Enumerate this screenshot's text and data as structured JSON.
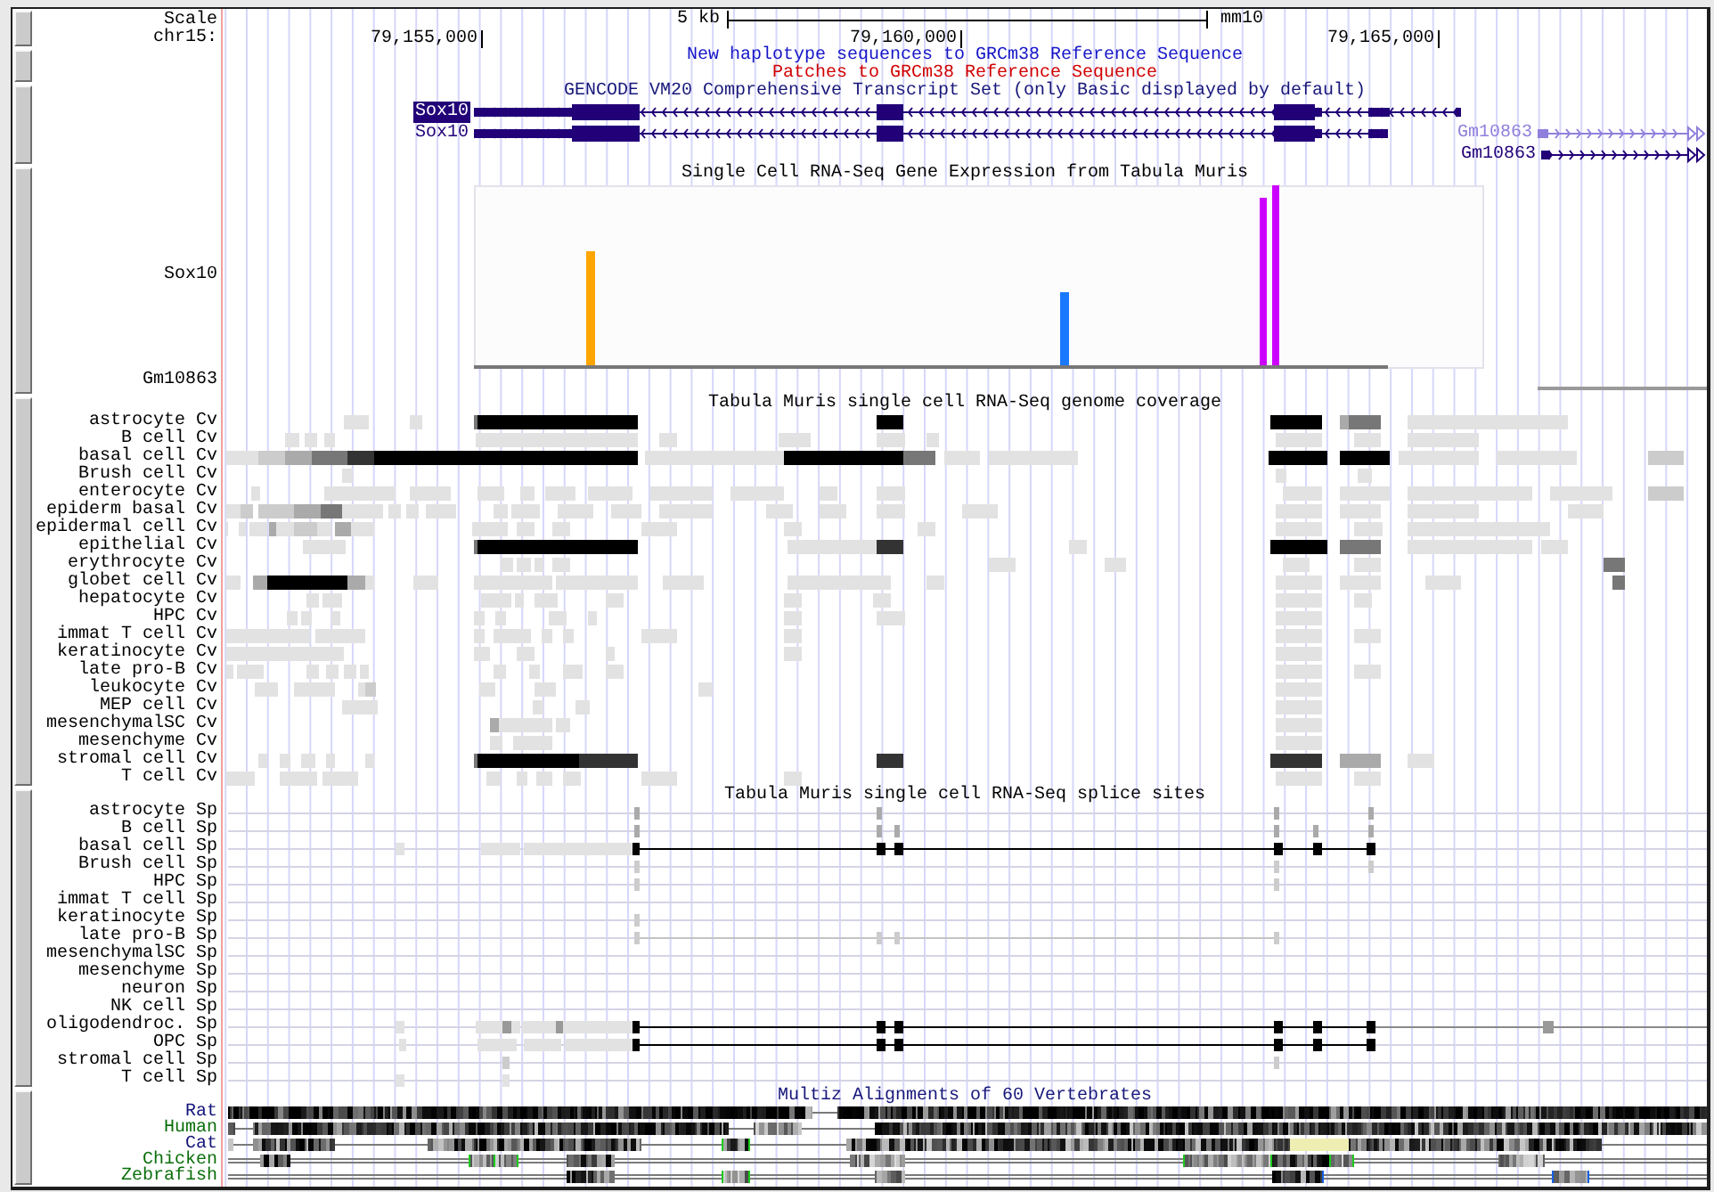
{
  "ruler": {
    "scale_label": "Scale",
    "chrom_label": "chr15:",
    "scale_bar": "5 kb",
    "assembly": "mm10",
    "positions": [
      "79,155,000",
      "79,160,000",
      "79,165,000"
    ]
  },
  "patches": {
    "subtracks": [
      {
        "title": "New haplotype sequences to GRCm38 Reference Sequence",
        "color": "#1414c8"
      },
      {
        "title": "Patches to GRCm38 Reference Sequence",
        "color": "#d20000"
      }
    ]
  },
  "gencode": {
    "title": "GENCODE VM20 Comprehensive Transcript Set (only Basic displayed by default)",
    "transcripts": [
      {
        "name": "Sox10",
        "highlighted": true,
        "color": "#220078"
      },
      {
        "name": "Sox10",
        "highlighted": false,
        "color": "#220078"
      },
      {
        "name": "Gm10863",
        "highlighted": false,
        "color": "#9080dc"
      },
      {
        "name": "Gm10863",
        "highlighted": false,
        "color": "#220078"
      }
    ]
  },
  "expression": {
    "title": "Single Cell RNA-Seq Gene Expression from Tabula Muris",
    "genes": [
      "Sox10",
      "Gm10863"
    ]
  },
  "coverage": {
    "title": "Tabula Muris single cell RNA-Seq genome coverage",
    "rows": [
      "astrocyte Cv",
      "B cell Cv",
      "basal cell Cv",
      "Brush cell Cv",
      "enterocyte Cv",
      "epiderm basal Cv",
      "epidermal cell Cv",
      "epithelial Cv",
      "erythrocyte Cv",
      "globet cell Cv",
      "hepatocyte Cv",
      "HPC Cv",
      "immat T cell Cv",
      "keratinocyte Cv",
      "late pro-B Cv",
      "leukocyte Cv",
      "MEP cell Cv",
      "mesenchymalSC Cv",
      "mesenchyme Cv",
      "stromal cell Cv",
      "T cell Cv"
    ]
  },
  "splice_sites": {
    "title": "Tabula Muris single cell RNA-Seq splice sites",
    "rows": [
      "astrocyte Sp",
      "B cell Sp",
      "basal cell Sp",
      "Brush cell Sp",
      "HPC Sp",
      "immat T cell Sp",
      "keratinocyte Sp",
      "late pro-B Sp",
      "mesenchymalSC Sp",
      "mesenchyme Sp",
      "neuron Sp",
      "NK cell Sp",
      "oligodendroc. Sp",
      "OPC Sp",
      "stromal cell Sp",
      "T cell Sp"
    ]
  },
  "multiz": {
    "title": "Multiz Alignments of 60 Vertebrates",
    "species": [
      {
        "name": "Rat",
        "color": "#14147a"
      },
      {
        "name": "Human",
        "color": "#0a6e0a"
      },
      {
        "name": "Cat",
        "color": "#14147a"
      },
      {
        "name": "Chicken",
        "color": "#0a6e0a"
      },
      {
        "name": "Zebrafish",
        "color": "#0a6e0a"
      }
    ]
  }
}
